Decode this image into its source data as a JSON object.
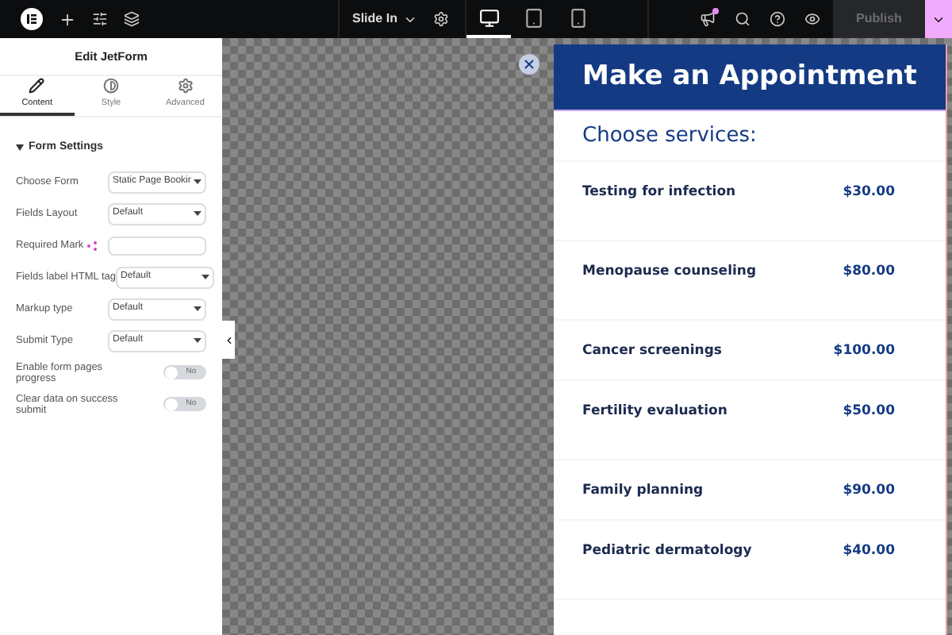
{
  "top_bar": {
    "template_name": "Slide In",
    "devices": [
      {
        "kind": "desktop",
        "selected": true
      },
      {
        "kind": "tablet",
        "selected": false
      },
      {
        "kind": "mobile",
        "selected": false
      }
    ],
    "notifications_unread": true,
    "publish": {
      "label": "Publish",
      "disabled": true
    }
  },
  "panel": {
    "title": "Edit JetForm",
    "tabs": [
      {
        "label": "Content",
        "selected": true
      },
      {
        "label": "Style",
        "selected": false
      },
      {
        "label": "Advanced",
        "selected": false
      }
    ],
    "section": {
      "title": "Form Settings",
      "expanded": true
    },
    "controls": [
      {
        "kind": "select",
        "label": "Choose Form",
        "value": "Static Page Bookir"
      },
      {
        "kind": "select",
        "label": "Fields Layout",
        "value": "Default"
      },
      {
        "kind": "text",
        "label": "Required Mark"
      },
      {
        "kind": "select",
        "label": "Fields label HTML tag",
        "value": "Default"
      },
      {
        "kind": "select",
        "label": "Markup type",
        "value": "Default"
      },
      {
        "kind": "select",
        "label": "Submit Type",
        "value": "Default"
      },
      {
        "kind": "toggle",
        "label": "Enable form pages progress",
        "on": false,
        "state_label": "No"
      },
      {
        "kind": "toggle",
        "label": "Clear data on success submit",
        "on": false,
        "state_label": "No"
      }
    ]
  },
  "popup": {
    "title": "Make an Appointment",
    "subtitle": "Choose services:",
    "services": [
      {
        "name": "Testing for infection",
        "price": "$30.00",
        "kind": "tall"
      },
      {
        "name": "Menopause counseling",
        "price": "$80.00",
        "kind": "tall"
      },
      {
        "name": "Cancer screenings",
        "price": "$100.00",
        "kind": "short"
      },
      {
        "name": "Fertility evaluation",
        "price": "$50.00",
        "kind": "tall"
      },
      {
        "name": "Family planning",
        "price": "$90.00",
        "kind": "short"
      },
      {
        "name": "Pediatric dermatology",
        "price": "$40.00",
        "kind": "tall"
      }
    ]
  }
}
